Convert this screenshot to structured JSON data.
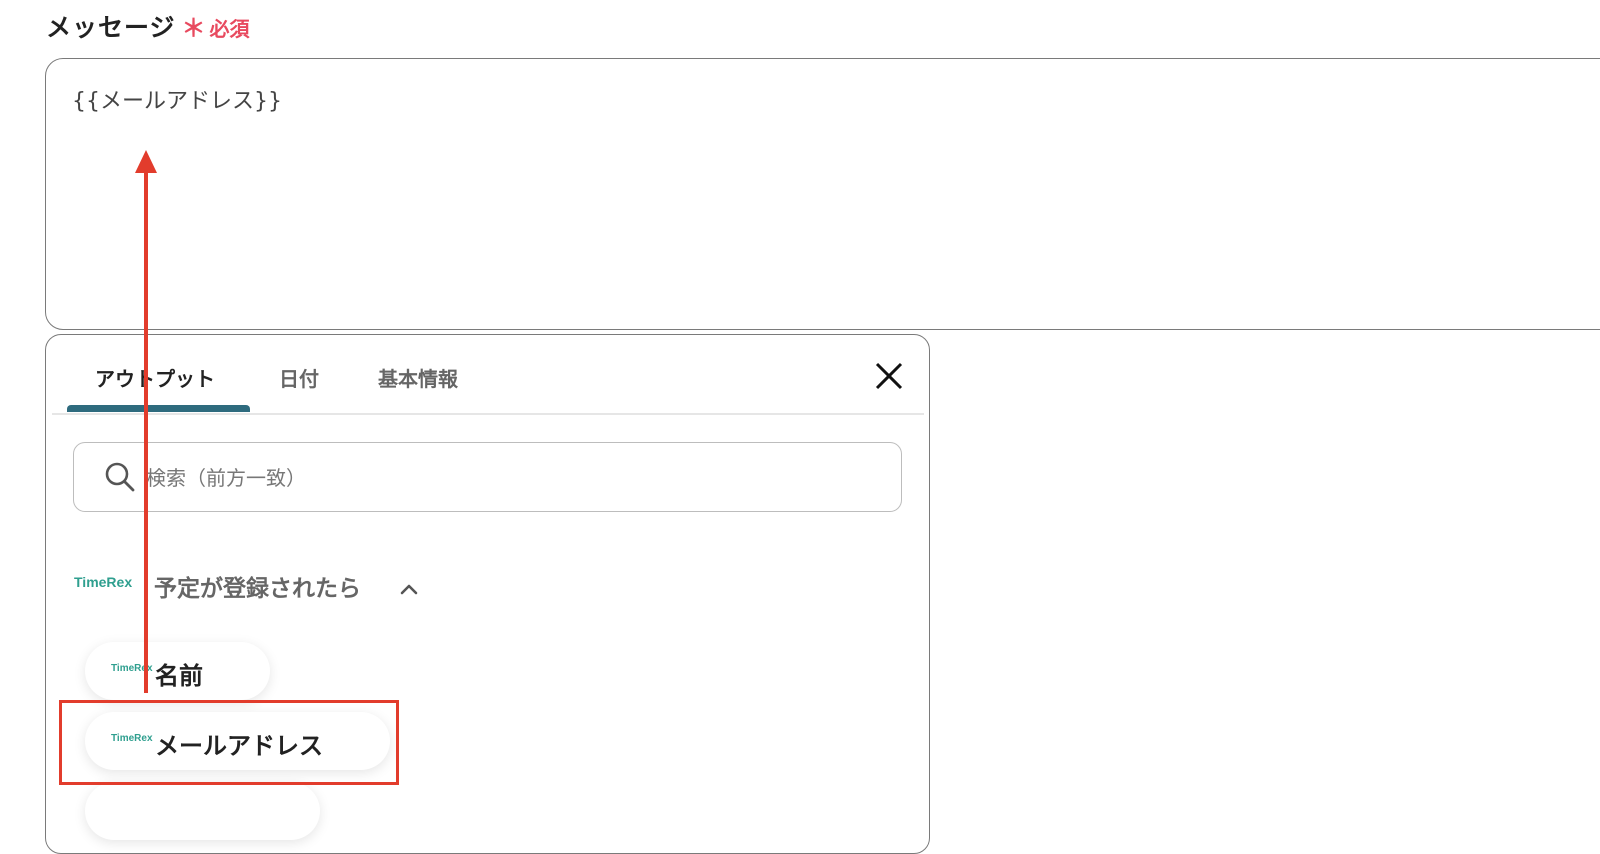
{
  "field": {
    "label": "メッセージ",
    "required_mark": "＊",
    "required_label": "必須",
    "value": "{{メールアドレス}}"
  },
  "panel": {
    "tabs": [
      {
        "label": "アウトプット",
        "active": true
      },
      {
        "label": "日付",
        "active": false
      },
      {
        "label": "基本情報",
        "active": false
      }
    ],
    "search": {
      "placeholder": "検索（前方一致）",
      "value": ""
    },
    "group": {
      "logo_text": "TimeRex",
      "title": "予定が登録されたら",
      "expanded": true
    },
    "items": [
      {
        "label": "名前",
        "logo_text": "TimeRex"
      },
      {
        "label": "メールアドレス",
        "logo_text": "TimeRex",
        "highlighted": true
      }
    ]
  },
  "colors": {
    "required": "#e84a5f",
    "tab_underline": "#2e6b7e",
    "annotation": "#e23c2c",
    "logo": "#2f9f8f"
  }
}
